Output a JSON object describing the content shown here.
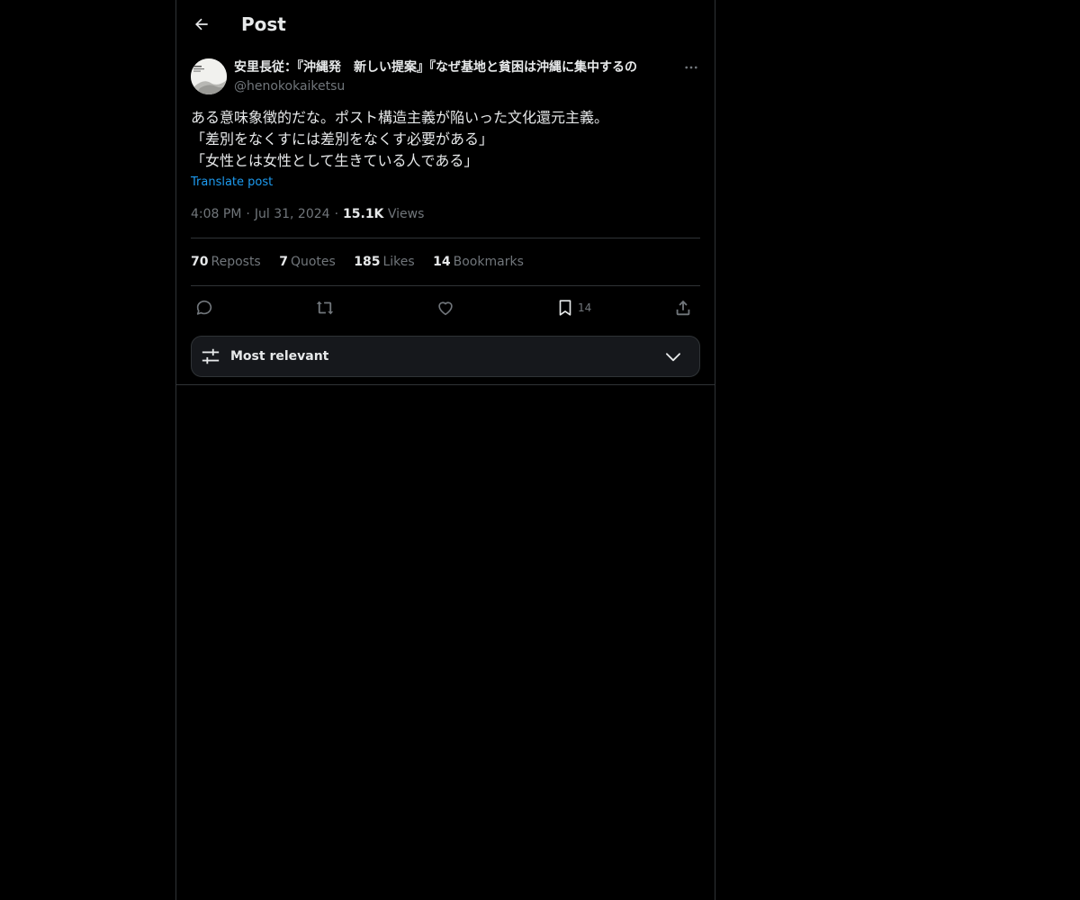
{
  "header": {
    "title": "Post",
    "back_icon": "arrow-left-icon"
  },
  "author": {
    "name": "安里長従：『沖縄発　新しい提案』『なぜ基地と貧困は沖縄に集中するの",
    "handle": "@henokokaiketsu"
  },
  "post": {
    "lines": [
      "ある意味象徴的だな。ポスト構造主義が陥いった文化還元主義。",
      "「差別をなくすには差別をなくす必要がある」",
      "「女性とは女性として生きている人である」"
    ],
    "translate_label": "Translate post",
    "time": "4:08 PM",
    "date": "Jul 31, 2024",
    "views_count": "15.1K",
    "views_label": "Views"
  },
  "stats": {
    "reposts": {
      "count": "70",
      "label": "Reposts"
    },
    "quotes": {
      "count": "7",
      "label": "Quotes"
    },
    "likes": {
      "count": "185",
      "label": "Likes"
    },
    "bookmarks": {
      "count": "14",
      "label": "Bookmarks"
    }
  },
  "actions": {
    "bookmark_count": "14"
  },
  "sort": {
    "label": "Most relevant"
  },
  "colors": {
    "background": "#000000",
    "text": "#e7e9ea",
    "muted": "#71767b",
    "link": "#1d9bf0",
    "border": "#2f3336"
  }
}
